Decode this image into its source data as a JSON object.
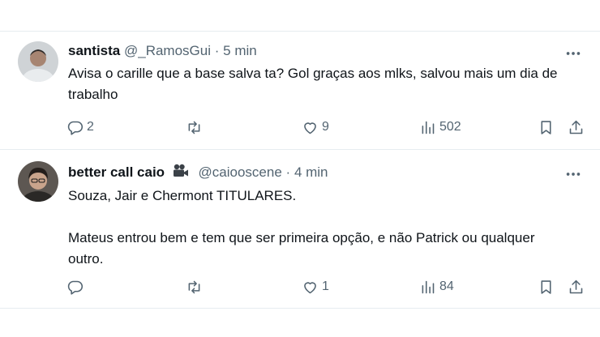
{
  "tweets": [
    {
      "display_name": "santista",
      "handle": "@_RamosGui",
      "separator": "·",
      "time": "5 min",
      "text_lines": [
        "Avisa o carille que a base salva ta? Gol graças aos mlks, salvou mais um dia de trabalho"
      ],
      "replies": "2",
      "retweets": "",
      "likes": "9",
      "views": "502",
      "avatar_icon": "user-avatar",
      "badge_icon": null
    },
    {
      "display_name": "better call caio",
      "handle": "@caiooscene",
      "separator": "·",
      "time": "4 min",
      "text_lines": [
        "Souza, Jair e Chermont TITULARES.",
        "",
        "Mateus entrou bem e tem que ser primeira opção, e não Patrick ou qualquer outro."
      ],
      "replies": "",
      "retweets": "",
      "likes": "1",
      "views": "84",
      "avatar_icon": "user-avatar",
      "badge_icon": "movie-camera-icon"
    }
  ],
  "colors": {
    "text": "#0f1419",
    "secondary": "#536471",
    "divider": "#e6ecf0",
    "background": "#ffffff"
  }
}
